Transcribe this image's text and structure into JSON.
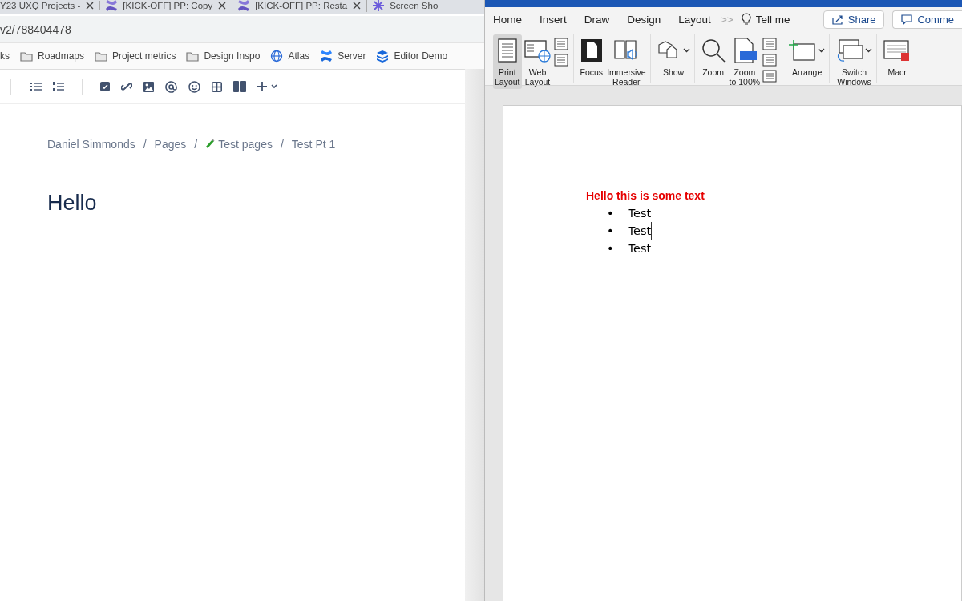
{
  "browser": {
    "tabs": [
      {
        "title": "Y23 UXQ Projects - ",
        "kind": "none"
      },
      {
        "title": "[KICK-OFF] PP: Copy",
        "kind": "confluence"
      },
      {
        "title": "[KICK-OFF] PP: Resta",
        "kind": "confluence"
      },
      {
        "title": "Screen Sho",
        "kind": "sparkle"
      }
    ],
    "address": "v2/788404478",
    "bookmarks": [
      {
        "label": "ks",
        "kind": "text"
      },
      {
        "label": "Roadmaps",
        "kind": "folder"
      },
      {
        "label": "Project metrics",
        "kind": "folder"
      },
      {
        "label": "Design Inspo",
        "kind": "folder"
      },
      {
        "label": "Atlas",
        "kind": "globe"
      },
      {
        "label": "Server",
        "kind": "confluence"
      },
      {
        "label": "Editor Demo",
        "kind": "stack"
      }
    ],
    "breadcrumbs": [
      {
        "label": "Daniel Simmonds",
        "kind": "text"
      },
      {
        "label": "/",
        "kind": "separator"
      },
      {
        "label": "Pages",
        "kind": "text"
      },
      {
        "label": "/",
        "kind": "separator"
      },
      {
        "label": "Test pages",
        "kind": "emoji"
      },
      {
        "label": "/",
        "kind": "separator"
      },
      {
        "label": "Test Pt 1",
        "kind": "text"
      }
    ],
    "page_title": "Hello"
  },
  "word": {
    "tabs": [
      "Home",
      "Insert",
      "Draw",
      "Design",
      "Layout"
    ],
    "overflow": ">>",
    "tell_me": "Tell me",
    "share": "Share",
    "comments": "Comme",
    "ribbon": [
      {
        "label": "Print\nLayout",
        "kind": "large",
        "selected": true
      },
      {
        "label": "Web\nLayout",
        "kind": "large",
        "selected": false
      },
      {
        "kind": "pair"
      },
      {
        "label": "Focus",
        "kind": "large",
        "selected": false
      },
      {
        "label": "Immersive\nReader",
        "kind": "large",
        "selected": false
      },
      {
        "label": "Show",
        "kind": "dropdown",
        "selected": false
      },
      {
        "label": "Zoom",
        "kind": "large",
        "selected": false
      },
      {
        "label": "Zoom\nto 100%",
        "kind": "large",
        "selected": false
      },
      {
        "kind": "triple"
      },
      {
        "label": "Arrange",
        "kind": "dropdown",
        "selected": false
      },
      {
        "label": "Switch\nWindows",
        "kind": "dropdown",
        "selected": false
      },
      {
        "label": "Macr",
        "kind": "large",
        "selected": false
      }
    ],
    "document": {
      "heading": "Hello this is some text",
      "bullets": [
        {
          "marker": "•",
          "text": "Test",
          "cursor": false
        },
        {
          "marker": "•",
          "text": "Test",
          "cursor": true
        },
        {
          "marker": "•",
          "text": "Test",
          "cursor": false
        }
      ]
    }
  }
}
